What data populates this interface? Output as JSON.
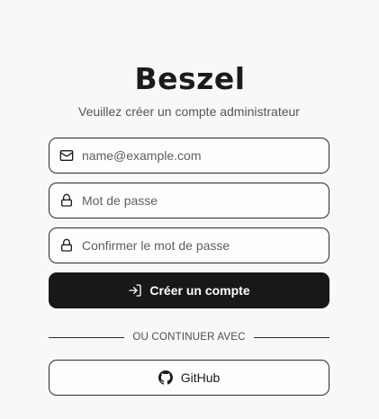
{
  "app": {
    "logo_text": "Beszel",
    "subtitle": "Veuillez créer un compte administrateur"
  },
  "form": {
    "email": {
      "placeholder": "name@example.com",
      "value": "",
      "icon": "mail-icon"
    },
    "password": {
      "placeholder": "Mot de passe",
      "value": "",
      "icon": "lock-icon"
    },
    "confirm_password": {
      "placeholder": "Confirmer le mot de passe",
      "value": "",
      "icon": "lock-icon"
    },
    "submit": {
      "label": "Créer un compte",
      "icon": "log-in-icon"
    }
  },
  "divider": {
    "text": "OU CONTINUER AVEC"
  },
  "oauth": {
    "github_label": "GitHub",
    "icon": "github-icon"
  },
  "colors": {
    "background": "#f8f8f8",
    "primary": "#18181b",
    "border": "#2a2a2c",
    "muted_text": "#55565a"
  }
}
